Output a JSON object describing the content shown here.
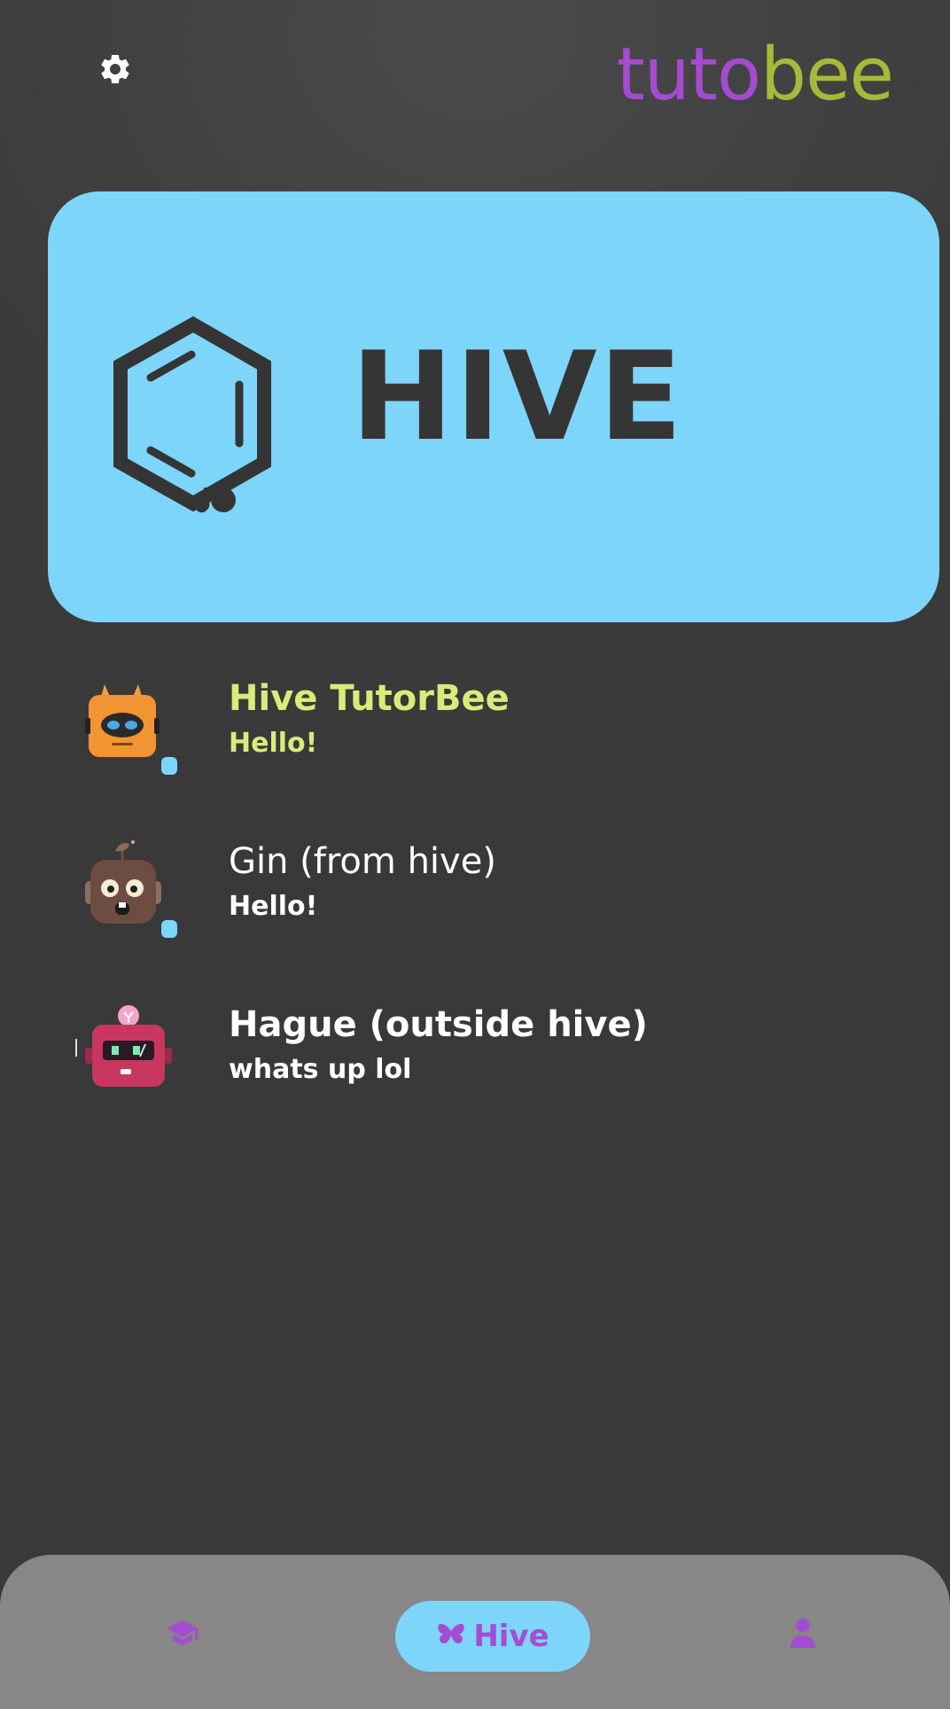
{
  "header": {
    "logo_part1": "tuto",
    "logo_part2": "bee",
    "logo_color1": "#a54bd0",
    "logo_color2": "#a7b83a",
    "settings_icon": "gear-icon"
  },
  "hero": {
    "title": "HIVE",
    "icon": "honeycomb-hexagon-icon",
    "background": "#7dd5fa"
  },
  "chats": [
    {
      "name": "Hive TutorBee",
      "message": "Hello!",
      "name_color": "#dbea7a",
      "unread": true,
      "avatar": "orange-robot-avatar"
    },
    {
      "name": "Gin (from hive)",
      "message": "Hello!",
      "name_color": "#ffffff",
      "unread": true,
      "avatar": "brown-robot-avatar"
    },
    {
      "name": "Hague (outside hive)",
      "message": "whats up lol",
      "name_color": "#ffffff",
      "unread": false,
      "avatar": "pink-robot-avatar"
    }
  ],
  "bottom_nav": {
    "learn_icon": "graduation-cap-icon",
    "hive_label": "Hive",
    "hive_icon": "butterfly-icon",
    "profile_icon": "person-icon",
    "active": "Hive",
    "accent": "#a24dd2"
  }
}
